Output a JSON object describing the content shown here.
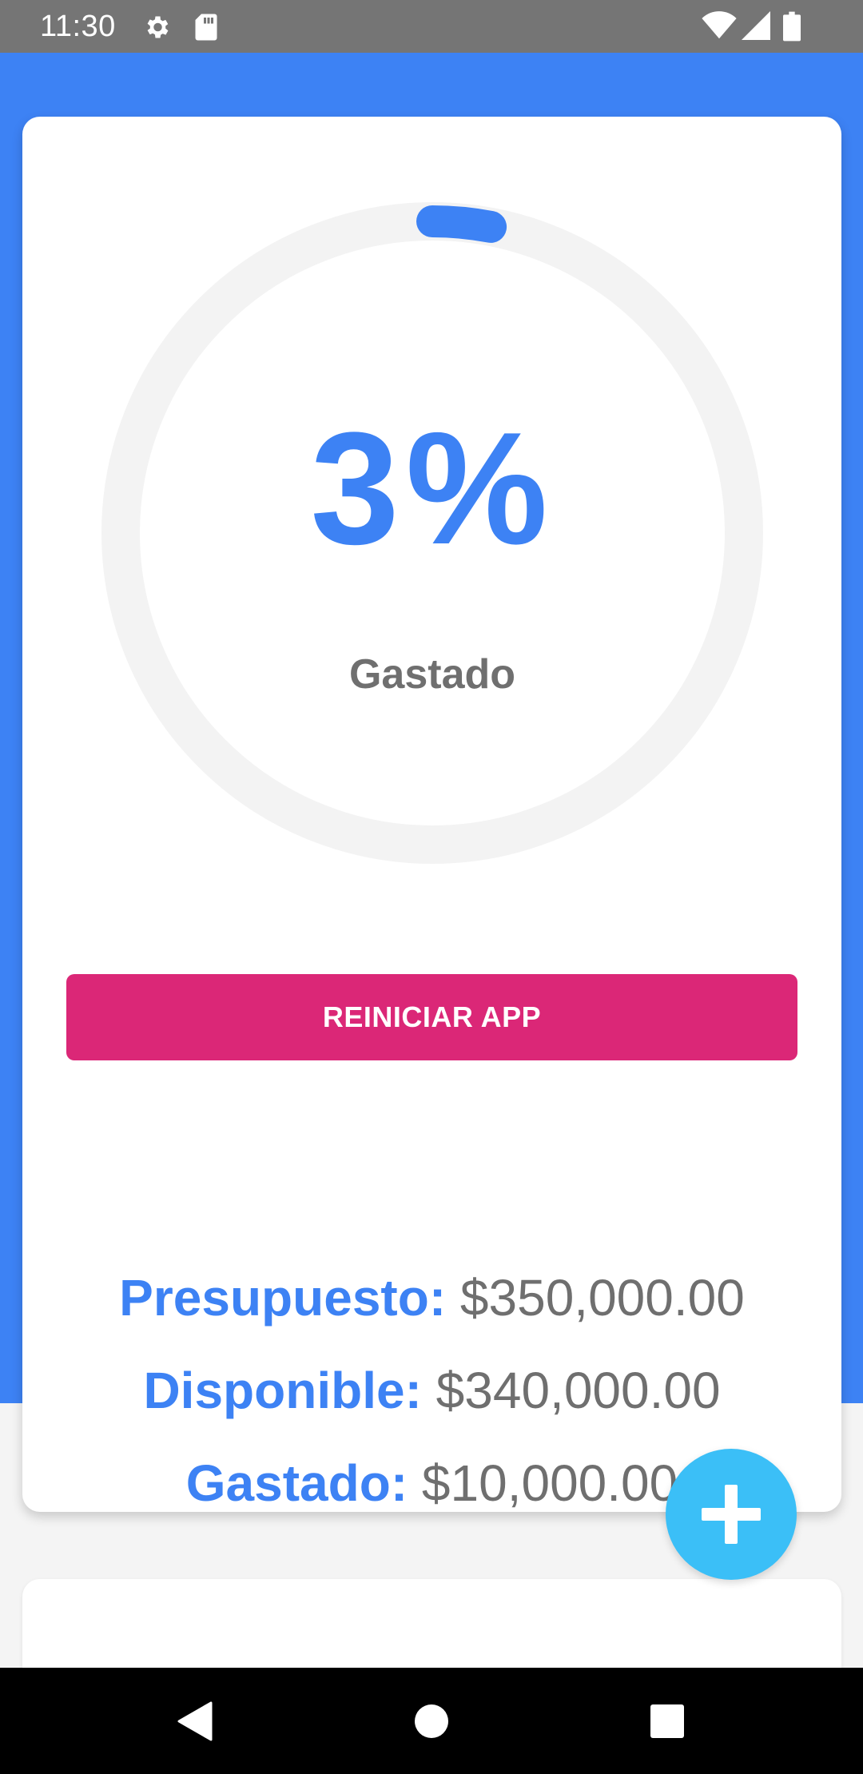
{
  "status_bar": {
    "time": "11:30",
    "icons": [
      "gear-icon",
      "sd-card-icon",
      "wifi-icon",
      "cell-signal-icon",
      "battery-icon"
    ]
  },
  "budget": {
    "percent_spent": 3,
    "percent_label": "3%",
    "spent_caption": "Gastado",
    "reset_button": "REINICIAR APP",
    "summary": [
      {
        "label": "Presupuesto:",
        "value": "$350,000.00"
      },
      {
        "label": "Disponible:",
        "value": "$340,000.00"
      },
      {
        "label": "Gastado:",
        "value": "$10,000.00"
      }
    ]
  },
  "fab": {
    "icon": "plus-icon"
  },
  "nav_bar": {
    "icons": [
      "back-icon",
      "home-icon",
      "recents-icon"
    ]
  },
  "colors": {
    "primary": "#3d82f4",
    "accent_button": "#db2777",
    "fab": "#3bbff7",
    "track": "#f3f3f3",
    "text_muted": "#6f6f6f",
    "status_bar": "#757575"
  }
}
